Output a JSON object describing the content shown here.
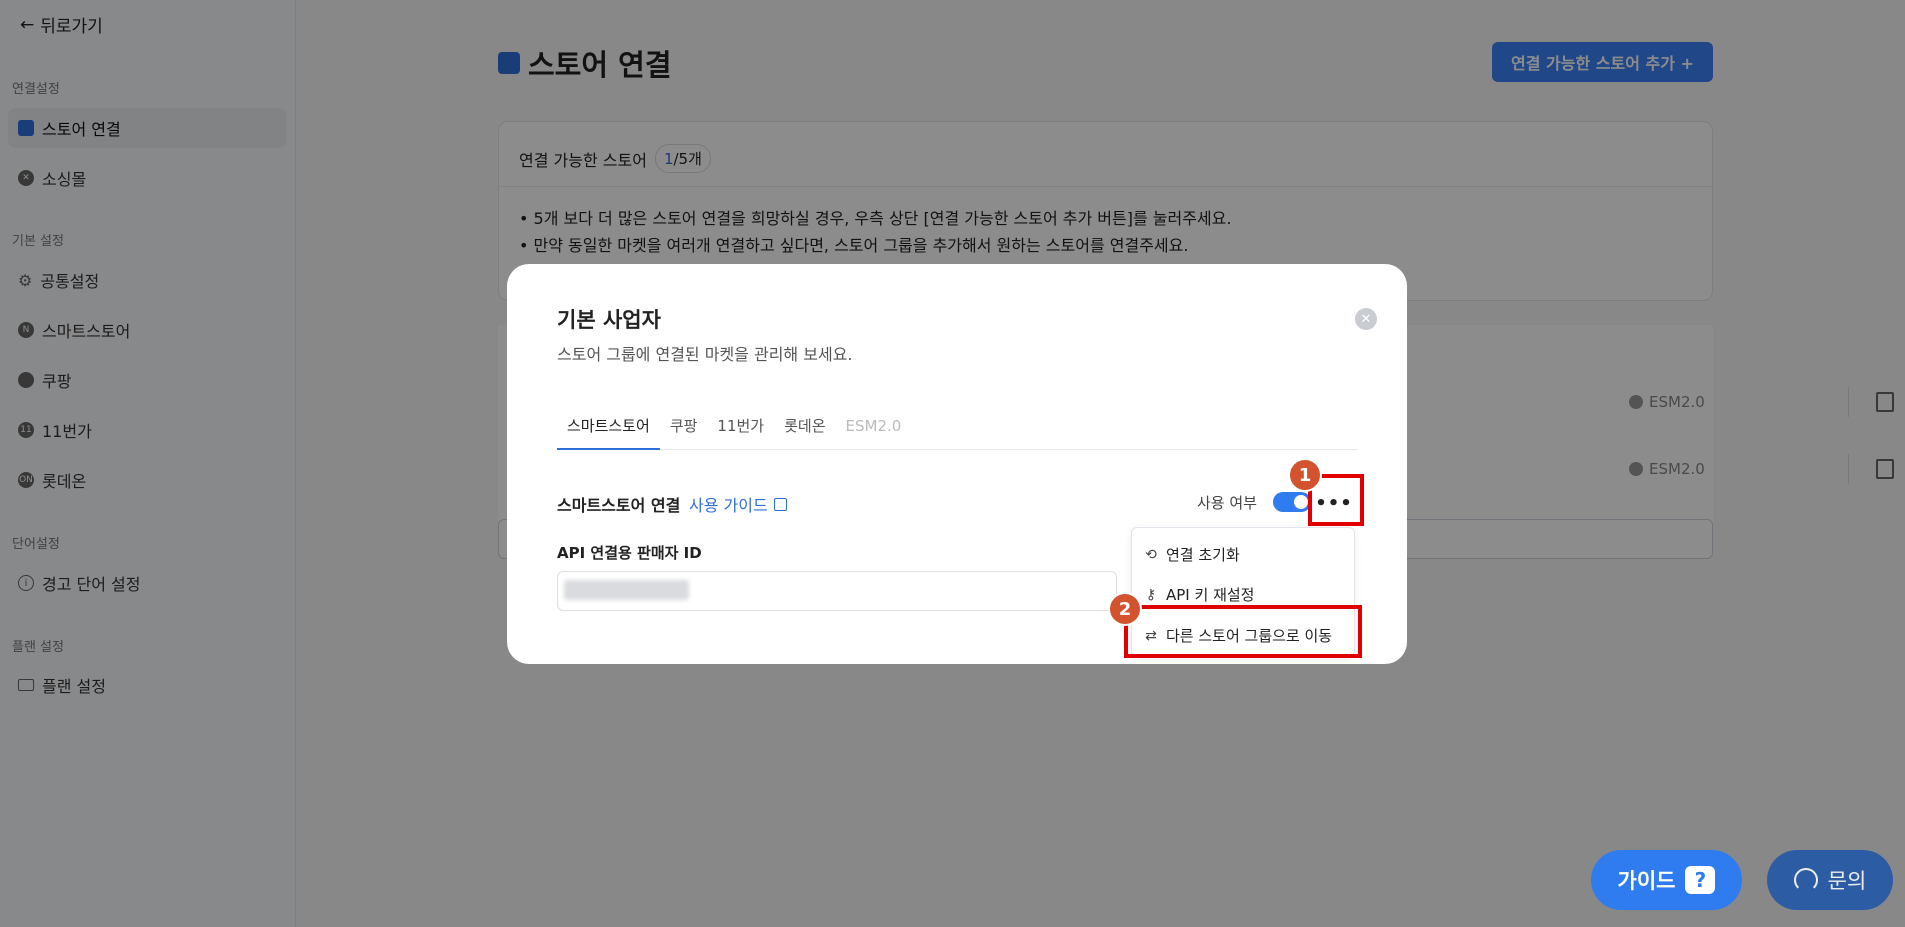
{
  "sidebar": {
    "back_label": "뒤로가기",
    "sections": [
      {
        "title": "연결설정",
        "items": [
          {
            "label": "스토어 연결",
            "active": true
          },
          {
            "label": "소싱몰"
          }
        ]
      },
      {
        "title": "기본 설정",
        "items": [
          {
            "label": "공통설정"
          },
          {
            "label": "스마트스토어"
          },
          {
            "label": "쿠팡"
          },
          {
            "label": "11번가"
          },
          {
            "label": "롯데온"
          }
        ]
      },
      {
        "title": "단어설정",
        "items": [
          {
            "label": "경고 단어 설정"
          }
        ]
      },
      {
        "title": "플랜 설정",
        "items": [
          {
            "label": "플랜 설정"
          }
        ]
      }
    ]
  },
  "main": {
    "title": "스토어 연결",
    "add_button": "연결 가능한 스토어 추가 +",
    "info": {
      "heading": "연결 가능한 스토어",
      "count_current": "1",
      "count_rest": "/5개",
      "bullets": [
        "• 5개 보다 더 많은 스토어 연결을 희망하실 경우, 우측 상단 [연결 가능한 스토어 추가 버튼]를 눌러주세요.",
        "• 만약 동일한 마켓을 여러개 연결하고 싶다면, 스토어 그룹을 추가해서 원하는 스토어를 연결주세요."
      ]
    },
    "row_tags": [
      "ESM2.0",
      "ESM2.0"
    ]
  },
  "modal": {
    "title": "기본 사업자",
    "subtitle": "스토어 그룹에 연결된 마켓을 관리해 보세요.",
    "tabs": [
      {
        "label": "스마트스토어",
        "state": "active"
      },
      {
        "label": "쿠팡",
        "state": "normal"
      },
      {
        "label": "11번가",
        "state": "normal"
      },
      {
        "label": "롯데온",
        "state": "normal"
      },
      {
        "label": "ESM2.0",
        "state": "disabled"
      }
    ],
    "conn_label": "스마트스토어 연결",
    "guide_link": "사용 가이드",
    "use_label": "사용 여부",
    "toggle_on": true,
    "more_label": "•••",
    "api_label": "API 연결용 판매자 ID",
    "dropdown": [
      {
        "icon": "reset-icon",
        "label": "연결 초기화"
      },
      {
        "icon": "key-icon",
        "label": "API 키 재설정"
      },
      {
        "icon": "swap-icon",
        "label": "다른 스토어 그룹으로 이동"
      }
    ]
  },
  "annotations": {
    "badge1": "1",
    "badge2": "2",
    "color": "#e00000"
  },
  "floating": {
    "guide_label": "가이드",
    "guide_icon": "?",
    "ask_label": "문의"
  },
  "colors": {
    "accent": "#2f7bf0",
    "overlay": "rgba(0,0,0,0.45)"
  }
}
